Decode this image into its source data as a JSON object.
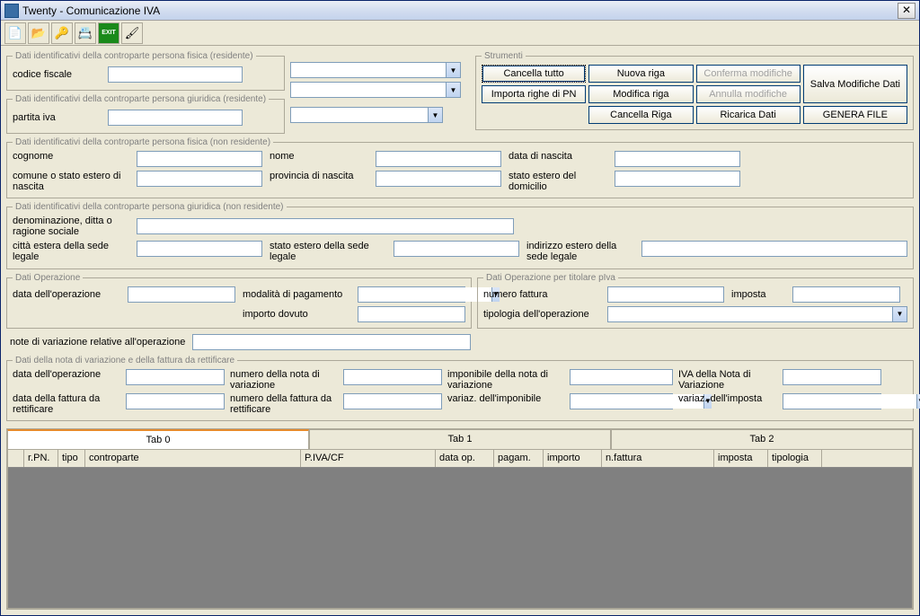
{
  "window": {
    "title": "Twenty - Comunicazione IVA"
  },
  "toolbar": {
    "icons": [
      "doc-icon",
      "open-icon",
      "key-icon",
      "print-icon",
      "exit-icon",
      "brush-icon"
    ],
    "labels": [
      "📄",
      "📂",
      "🔑",
      "📇",
      "EXIT",
      "🖌"
    ]
  },
  "groups": {
    "pf_res": {
      "legend": "Dati identificativi della controparte persona fisica (residente)",
      "codice_fiscale": "codice fiscale"
    },
    "pg_res": {
      "legend": "Dati identificativi della controparte persona giuridica (residente)",
      "partita_iva": "partita iva"
    },
    "pf_nonres": {
      "legend": "Dati identificativi della controparte persona fisica (non residente)",
      "cognome": "cognome",
      "nome": "nome",
      "data_nascita": "data di nascita",
      "comune": "comune o stato estero di nascita",
      "provincia": "provincia di nascita",
      "stato_estero": "stato estero del domicilio"
    },
    "pg_nonres": {
      "legend": "Dati identificativi della controparte persona giuridica (non residente)",
      "denominazione": "denominazione, ditta o ragione sociale",
      "citta": "città estera della sede legale",
      "stato": "stato estero della sede legale",
      "indirizzo": "indirizzo estero della sede legale"
    },
    "operazione": {
      "legend": "Dati Operazione",
      "data": "data dell'operazione",
      "modalita": "modalità di pagamento",
      "importo": "importo dovuto"
    },
    "titolare": {
      "legend": "Dati Operazione per titolare pIva",
      "numero_fattura": "numero fattura",
      "imposta": "imposta",
      "tipologia": "tipologia dell'operazione"
    },
    "nota": {
      "legend": "Dati della nota di variazione e della fattura da rettificare",
      "data_op": "data dell'operazione",
      "data_fattura": "data della fattura da rettificare",
      "numero_nota": "numero della nota di variazione",
      "numero_fattura": "numero della fattura da rettificare",
      "imponibile": "imponibile della nota di variazione",
      "variaz_imponibile": "variaz. dell'imponibile",
      "iva_nota": "IVA della Nota di Variazione",
      "variaz_imposta": "variaz. dell'imposta"
    }
  },
  "note_label": "note di variazione relative all'operazione",
  "strumenti": {
    "legend": "Strumenti",
    "cancella_tutto": "Cancella tutto",
    "nuova_riga": "Nuova riga",
    "conferma": "Conferma modifiche",
    "salva": "Salva Modifiche Dati",
    "importa": "Importa righe di PN",
    "modifica": "Modifica riga",
    "annulla": "Annulla modifiche",
    "cancella_riga": "Cancella Riga",
    "ricarica": "Ricarica Dati",
    "genera": "GENERA FILE"
  },
  "tabs": {
    "t0": "Tab 0",
    "t1": "Tab 1",
    "t2": "Tab 2"
  },
  "grid": {
    "cols": {
      "rpn": "r.PN.",
      "tipo": "tipo",
      "controparte": "controparte",
      "piva": "P.IVA/CF",
      "dataop": "data op.",
      "pagam": "pagam.",
      "importo": "importo",
      "nfattura": "n.fattura",
      "imposta": "imposta",
      "tipologia": "tipologia"
    }
  }
}
